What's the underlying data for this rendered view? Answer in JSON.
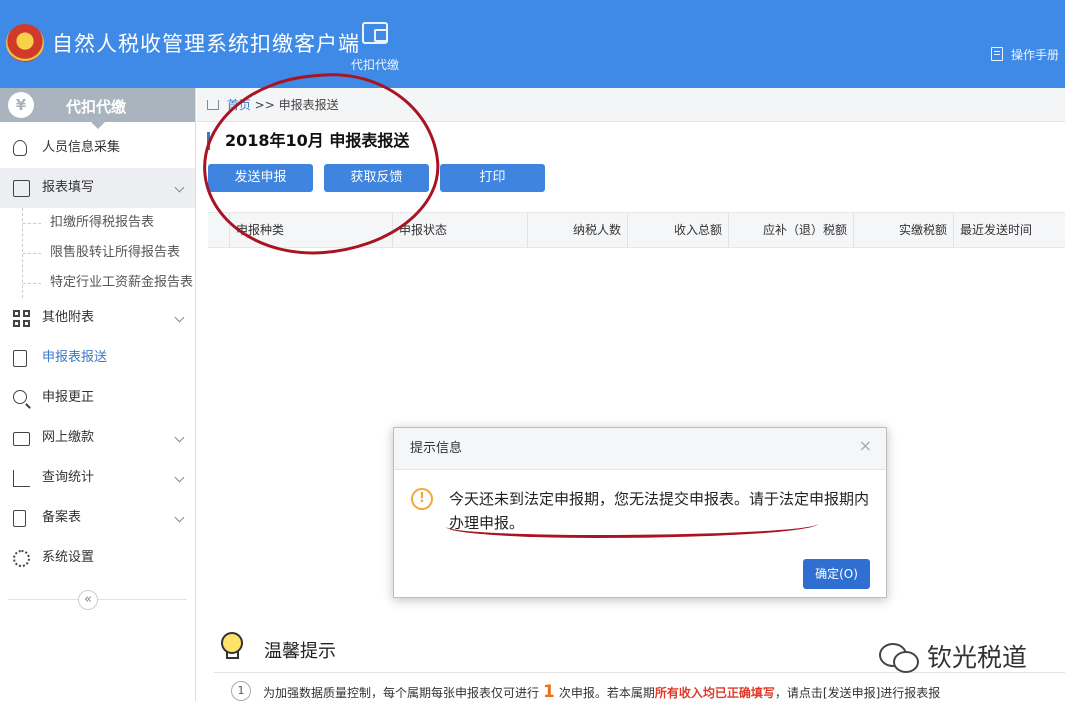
{
  "header": {
    "app_title": "自然人税收管理系统扣缴客户端",
    "nav_label": "代扣代缴",
    "manual_label": "操作手册"
  },
  "sidebar": {
    "title": "代扣代缴",
    "items": [
      {
        "label": "人员信息采集"
      },
      {
        "label": "报表填写"
      },
      {
        "label": "其他附表"
      },
      {
        "label": "申报表报送"
      },
      {
        "label": "申报更正"
      },
      {
        "label": "网上缴款"
      },
      {
        "label": "查询统计"
      },
      {
        "label": "备案表"
      },
      {
        "label": "系统设置"
      }
    ],
    "sub_items": [
      {
        "label": "扣缴所得税报告表"
      },
      {
        "label": "限售股转让所得报告表"
      },
      {
        "label": "特定行业工资薪金报告表"
      }
    ],
    "collapse": "«"
  },
  "breadcrumb": {
    "home": "首页",
    "sep": ">>",
    "current": "申报表报送"
  },
  "page": {
    "heading": "2018年10月  申报表报送",
    "buttons": [
      "发送申报",
      "获取反馈",
      "打印"
    ],
    "columns": [
      "申报种类",
      "申报状态",
      "纳税人数",
      "收入总额",
      "应补（退）税额",
      "实缴税额",
      "最近发送时间"
    ]
  },
  "dialog": {
    "title": "提示信息",
    "close": "×",
    "icon": "!",
    "message": "今天还未到法定申报期，您无法提交申报表。请于法定申报期内办理申报。",
    "ok": "确定(O)"
  },
  "tips": {
    "title": "温馨提示",
    "num": "1",
    "text_a": "为加强数据质量控制，每个属期每张申报表仅可进行",
    "text_big": "1",
    "text_b": "次申报。若本属期",
    "text_hl": "所有收入均已正确填写",
    "text_c": "，请点击[发送申报]进行报表报"
  },
  "watermark": "钦光税道"
}
